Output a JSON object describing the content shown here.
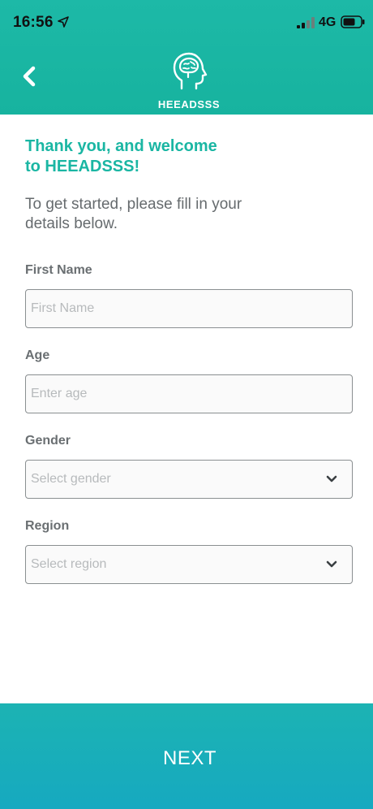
{
  "status_bar": {
    "time": "16:56",
    "network": "4G",
    "icons": [
      "location-arrow-icon",
      "cellular-signal-icon",
      "battery-icon"
    ]
  },
  "header": {
    "app_name": "HEEADSSS",
    "back_icon": "chevron-left-icon",
    "logo_icon": "head-brain-icon"
  },
  "welcome": {
    "title_line1": "Thank you, and welcome",
    "title_line2": "to HEEADSSS!",
    "intro_line1": "To get started, please fill in your",
    "intro_line2": "details below."
  },
  "form": {
    "first_name": {
      "label": "First Name",
      "placeholder": "First Name",
      "value": ""
    },
    "age": {
      "label": "Age",
      "placeholder": "Enter age",
      "value": ""
    },
    "gender": {
      "label": "Gender",
      "selected": "Select gender"
    },
    "region": {
      "label": "Region",
      "selected": "Select region"
    }
  },
  "footer": {
    "next_label": "NEXT"
  },
  "colors": {
    "primary_teal": "#1ab6a3",
    "footer_teal": "#17abbd",
    "label_gray": "#6a6f72"
  }
}
